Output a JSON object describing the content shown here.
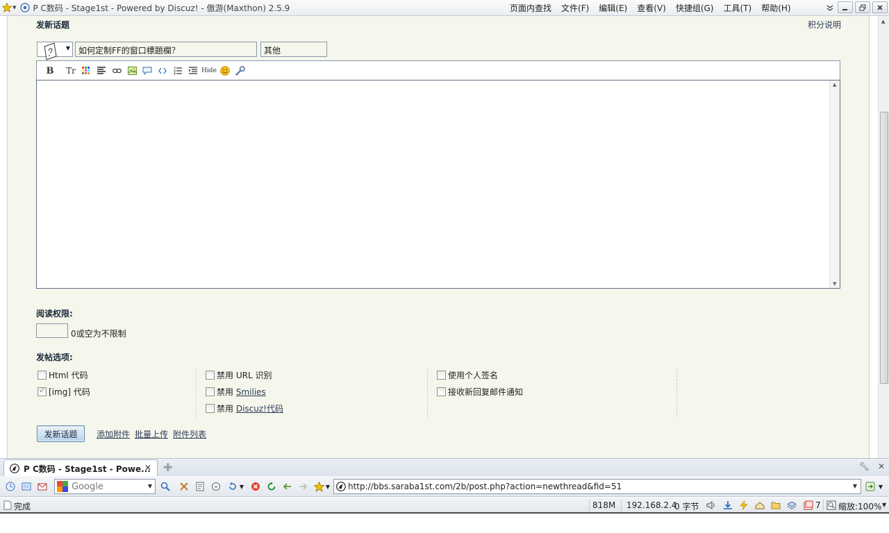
{
  "window": {
    "title": "P C数码 - Stage1st - Powered by Discuz! - 傲游(Maxthon) 2.5.9",
    "menus": [
      "页面内查找",
      "文件(F)",
      "编辑(E)",
      "查看(V)",
      "快捷组(G)",
      "工具(T)",
      "帮助(H)"
    ]
  },
  "form": {
    "title": "发新话题",
    "credits_link": "积分说明",
    "subject_value": "如何定制FF的窗口標題欄？",
    "type_value": "其他",
    "read_perm_label": "阅读权限:",
    "read_perm_hint": "0或空为不限制",
    "post_options_label": "发帖选项:",
    "options": {
      "html": {
        "label": "Html 代码",
        "checked": false
      },
      "img": {
        "label": "[img] 代码",
        "checked": true
      },
      "disable_url_prefix": "禁用",
      "disable_url_label": "URL 识别",
      "disable_smilies_prefix": "禁用",
      "disable_smilies_link": "Smilies",
      "disable_discuz_prefix": "禁用",
      "disable_discuz_link": "Discuz!代码",
      "signature": "使用个人签名",
      "email_notify": "接收新回复邮件通知"
    },
    "submit_label": "发新话题",
    "attach_links": [
      "添加附件",
      "批量上传",
      "附件列表"
    ],
    "toolbar_hide_label": "Hide"
  },
  "tabs": [
    {
      "title": "P C数码 - Stage1st - Powe...",
      "active": true
    }
  ],
  "toolbar": {
    "search_placeholder": "Google",
    "url": "http://bbs.saraba1st.com/2b/post.php?action=newthread&fid=51"
  },
  "status": {
    "text": "完成",
    "memory": "818M",
    "ip": "192.168.2.4",
    "bytes": "0 字节",
    "tab_count": "7",
    "zoom": "缩放:100%"
  }
}
